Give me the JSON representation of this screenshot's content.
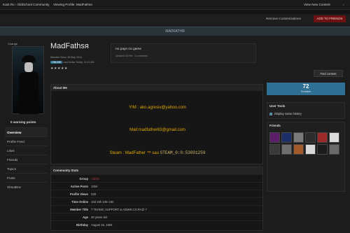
{
  "topbar": {
    "breadcrumb_1": "Kat2.Ro › OldSchool Community",
    "breadcrumb_2": "Viewing Profile: MadFathsя",
    "new_content": "View New Content",
    "user_menu": "›"
  },
  "bar2": {
    "remove": "Remove Customizations",
    "red_button": "ADD TO FRIENDS"
  },
  "namebar": {
    "title": "MADFATHЯ"
  },
  "left": {
    "avatar_label": "Change",
    "warning": "0 warning points",
    "nav": [
      "Overview",
      "Profile Feed",
      "Likes",
      "Friends",
      "Topics",
      "Posts",
      "ShoutBox"
    ]
  },
  "profile": {
    "name": "MadFathsя",
    "since": "Member Since 16 May 2014",
    "online": "ONLINE",
    "last_active": "Last Active Today, 11:21 AM",
    "stars": "★★★★★"
  },
  "status": {
    "text": "no payn no game",
    "meta": "Updated 03 Feb · 0 comments"
  },
  "about": {
    "title": "About Me",
    "ym": "Y!M : ako.agresiv@yahoo.com",
    "mail": "Mail:madfather63@gmail.com",
    "steam_prefix": "Steam : MadFather ™ sau ",
    "steam_id": "STEAM_0:0:53001259"
  },
  "stats": {
    "title": "Community Stats",
    "rows": [
      {
        "k": "Group",
        "v": "Admin"
      },
      {
        "k": "Active Posts",
        "v": "1004"
      },
      {
        "k": "Profile Views",
        "v": "228"
      },
      {
        "k": "Time Online",
        "v": "10d 18h 10m 16s"
      },
      {
        "k": "Member Title",
        "v": "7 TEHNIC SUPPORT & ADMIN CS.RAZI 7"
      },
      {
        "k": "Age",
        "v": "20 years old"
      },
      {
        "k": "Birthday",
        "v": "August 15, 1994"
      }
    ]
  },
  "right": {
    "find_content": "Find content",
    "rep_number": "72",
    "rep_label": "Excellent",
    "user_tools": "User Tools",
    "display_history": "Display name history",
    "friends": "Friends"
  },
  "colors": {
    "accent": "#2f6f93",
    "about_text": "#e0a800",
    "red_button": "#6b1111",
    "group_admin": "#b73b3b"
  }
}
